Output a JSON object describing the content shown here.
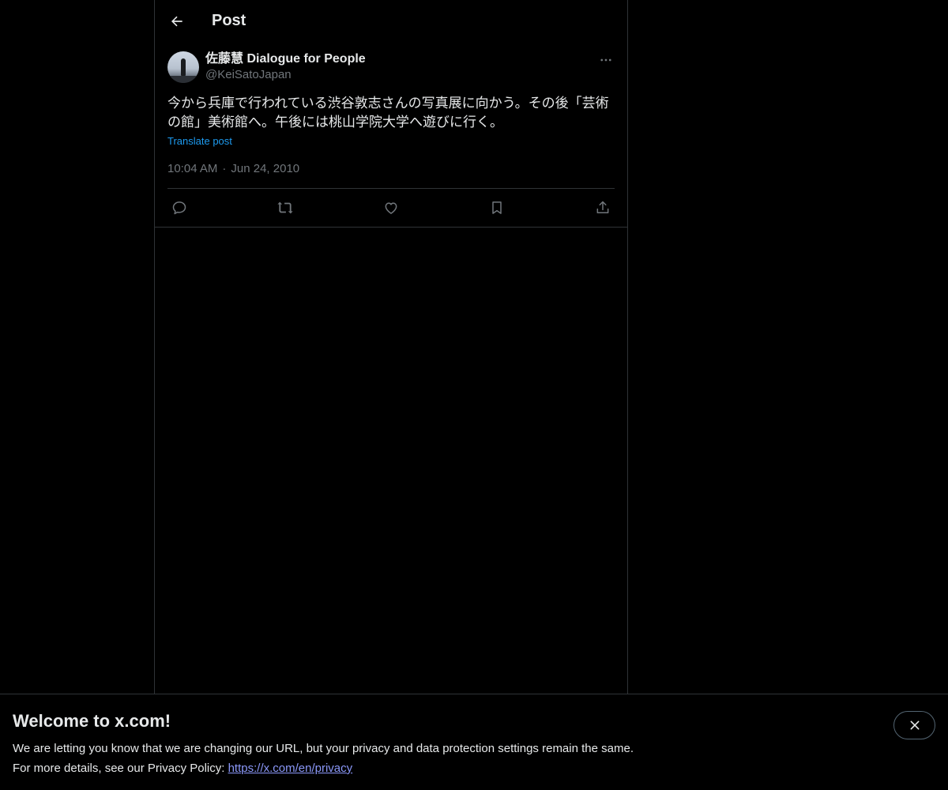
{
  "header": {
    "title": "Post"
  },
  "post": {
    "display_name": "佐藤慧 Dialogue for People",
    "handle": "@KeiSatoJapan",
    "text": "今から兵庫で行われている渋谷敦志さんの写真展に向かう。その後「芸術の館」美術館へ。午後には桃山学院大学へ遊びに行く。",
    "translate_label": "Translate post",
    "time": "10:04 AM",
    "date": "Jun 24, 2010",
    "separator": "·"
  },
  "actions": {
    "reply": "reply-icon",
    "repost": "repost-icon",
    "like": "heart-icon",
    "bookmark": "bookmark-icon",
    "share": "share-icon"
  },
  "banner": {
    "title": "Welcome to x.com!",
    "line1": "We are letting you know that we are changing our URL, but your privacy and data protection settings remain the same.",
    "line2_prefix": "For more details, see our Privacy Policy: ",
    "link": "https://x.com/en/privacy"
  },
  "colors": {
    "background": "#000000",
    "text": "#e7e9ea",
    "muted": "#71767b",
    "link": "#1d9bf0",
    "border": "#2f3336"
  }
}
